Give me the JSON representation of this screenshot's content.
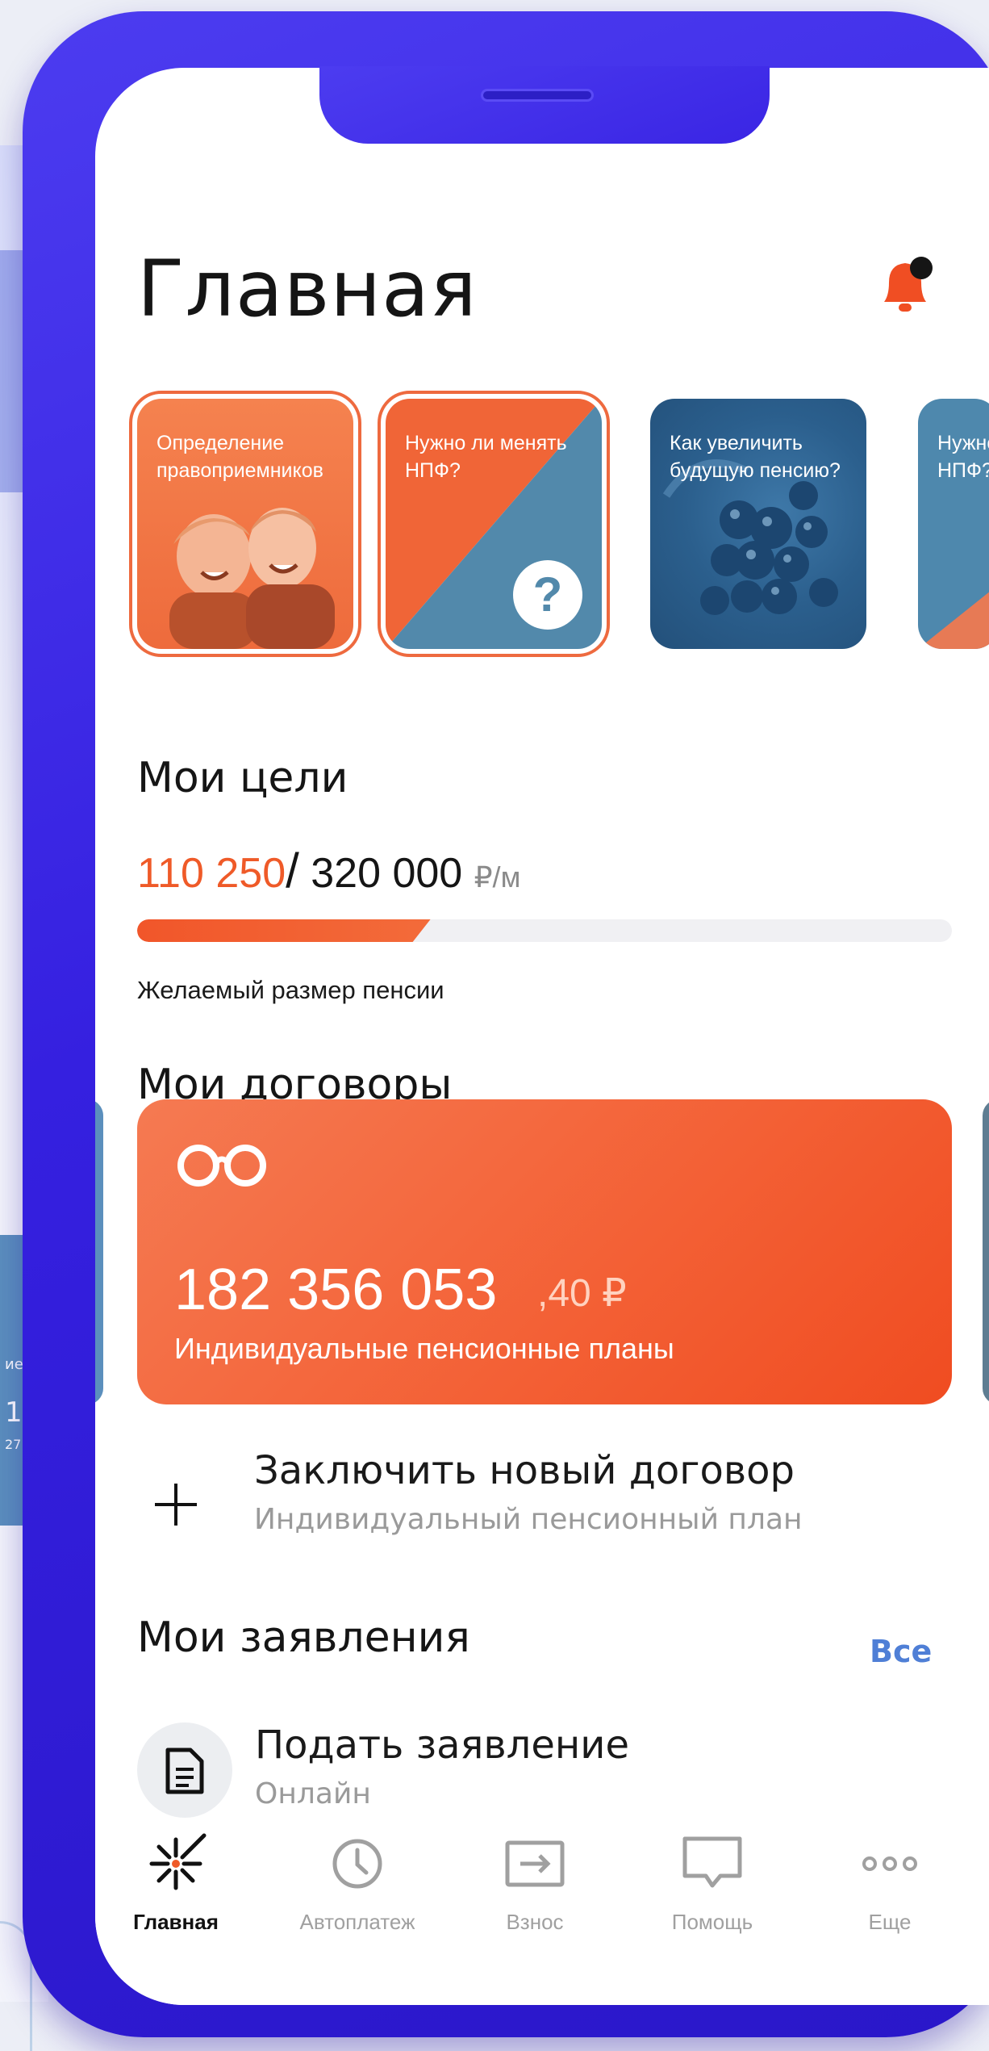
{
  "page": {
    "title": "Главная"
  },
  "stories": [
    {
      "label": "Определение правоприемников"
    },
    {
      "label": "Нужно ли менять НПФ?",
      "badge": "?"
    },
    {
      "label": "Как увеличить будущую пенсию?"
    },
    {
      "label": "Нужно ли менять НПФ?"
    }
  ],
  "goals": {
    "title": "Мои цели",
    "current": "110 250",
    "separator": "/",
    "target": "320 000",
    "unit": "₽/м",
    "progress": 0.36,
    "caption": "Желаемый размер пенсии"
  },
  "contracts": {
    "title": "Мои договоры",
    "card": {
      "amount": "182 356 053",
      "cents": ",40 ₽",
      "plan": "Индивидуальные пенсионные планы"
    },
    "new_contract": {
      "title": "Заключить новый договор",
      "subtitle": "Индивидуальный пенсионный план"
    }
  },
  "applications": {
    "title": "Мои заявления",
    "all_link": "Все",
    "item": {
      "title": "Подать заявление",
      "subtitle": "Онлайн"
    }
  },
  "tabbar": [
    {
      "label": "Главная",
      "icon": "sparkle-icon",
      "active": true
    },
    {
      "label": "Автоплатеж",
      "icon": "clock-icon",
      "active": false
    },
    {
      "label": "Взнос",
      "icon": "arrow-in-icon",
      "active": false
    },
    {
      "label": "Помощь",
      "icon": "chat-icon",
      "active": false
    },
    {
      "label": "Еще",
      "icon": "more-icon",
      "active": false
    }
  ],
  "colors": {
    "accent": "#ef5a28",
    "link": "#4f7fd6",
    "frame": "#3a25e4",
    "card_blue": "#4e88ad"
  }
}
